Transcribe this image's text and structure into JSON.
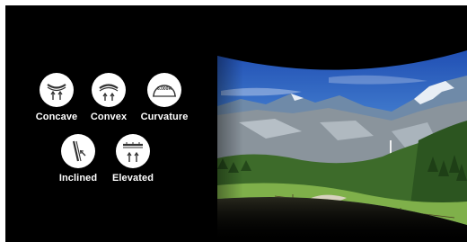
{
  "features": {
    "concave": {
      "label": "Concave",
      "icon": "concave-screen-icon"
    },
    "convex": {
      "label": "Convex",
      "icon": "convex-screen-icon"
    },
    "curvature": {
      "label": "Curvature",
      "icon": "curvature-screen-icon",
      "icon_text": "6.000R"
    },
    "inclined": {
      "label": "Inclined",
      "icon": "inclined-screen-icon"
    },
    "elevated": {
      "label": "Elevated",
      "icon": "elevated-screen-icon"
    }
  },
  "colors": {
    "background": "#000000",
    "icon_fill": "#ffffff",
    "icon_stroke": "#333333",
    "label": "#ffffff"
  }
}
